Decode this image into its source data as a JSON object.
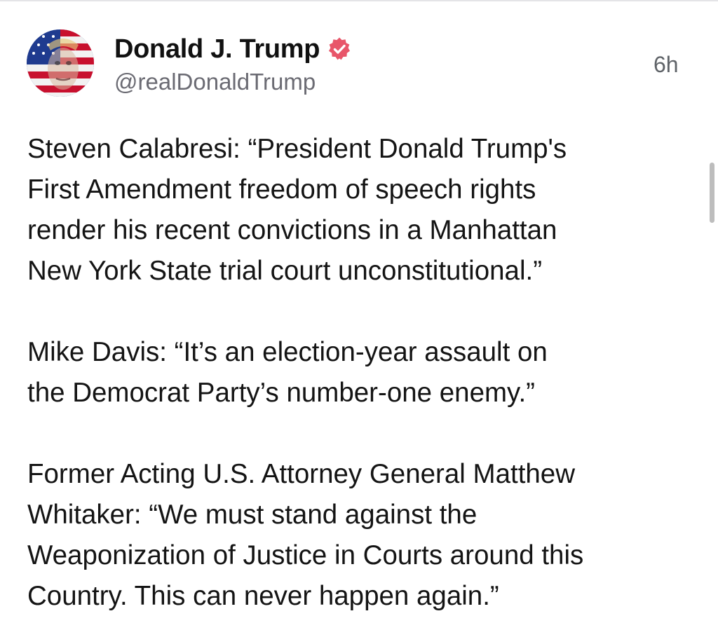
{
  "post": {
    "author": {
      "display_name": "Donald J. Trump",
      "handle": "@realDonaldTrump",
      "verified": true,
      "avatar_icon": "avatar-flag-portrait",
      "verified_icon": "verified-badge-icon",
      "verified_color": "#e8566a"
    },
    "timestamp": "6h",
    "paragraphs": [
      "Steven Calabresi: “President Donald Trump's\nFirst Amendment freedom of speech rights\nrender his recent convictions in a Manhattan\nNew York State trial court unconstitutional.”",
      "Mike Davis: “It’s an election-year assault on\nthe Democrat Party’s number-one enemy.”",
      "Former Acting U.S. Attorney General Matthew\nWhitaker: “We must stand against the\nWeaponization of Justice in Courts around this\nCountry. This can never happen again.”"
    ]
  }
}
